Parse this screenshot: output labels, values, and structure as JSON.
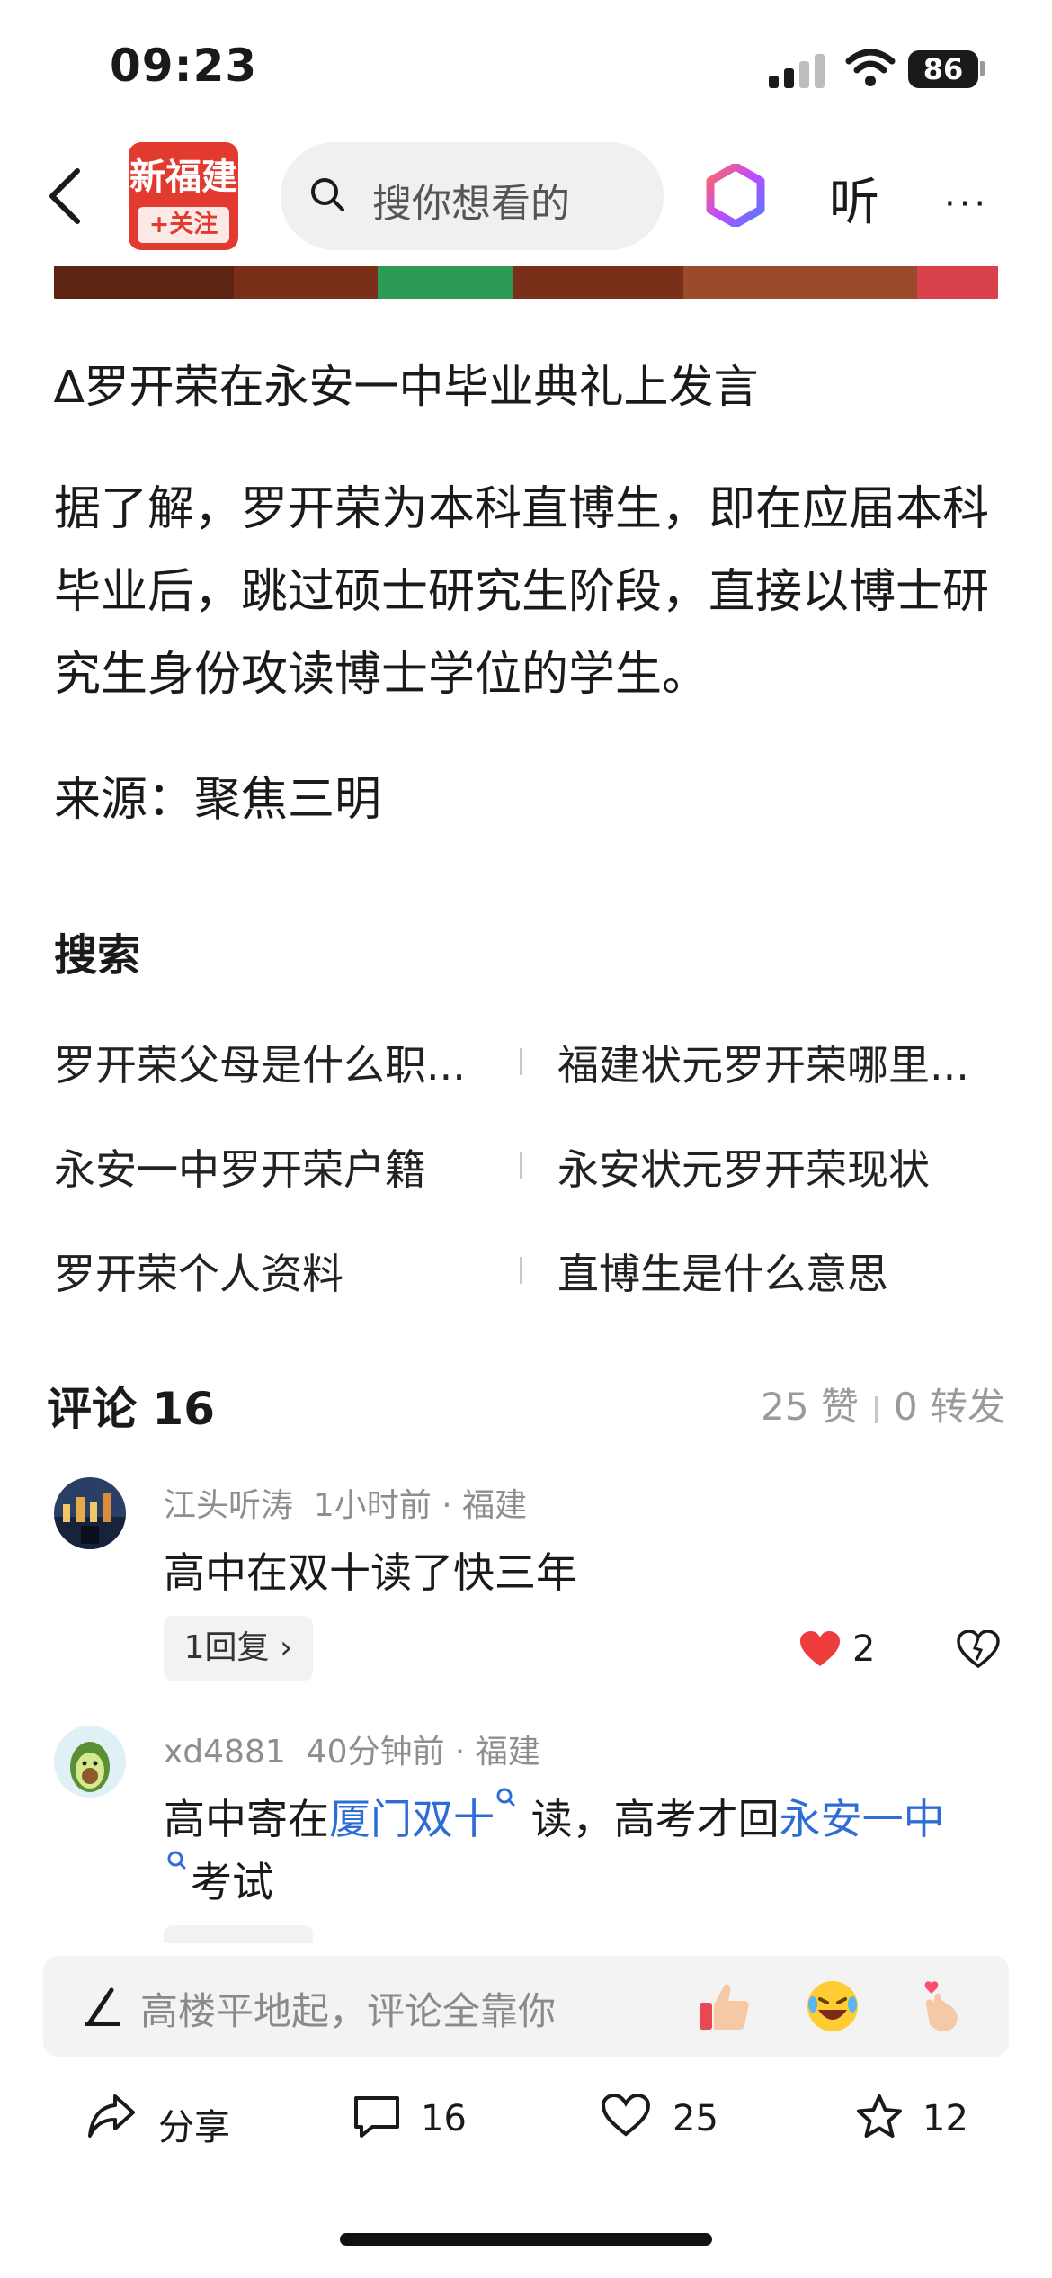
{
  "status": {
    "time": "09:23",
    "battery": "86"
  },
  "header": {
    "logo_top": "新福建",
    "follow_label": "+关注",
    "search_placeholder": "搜你想看的",
    "listen_label": "听",
    "more_label": "···"
  },
  "article": {
    "caption": "∆罗开荣在永安一中毕业典礼上发言",
    "paragraph": "据了解，罗开荣为本科直博生，即在应届本科毕业后，跳过硕士研究生阶段，直接以博士研究生身份攻读博士学位的学生。",
    "source": "来源：聚焦三明"
  },
  "search_section": {
    "title": "搜索",
    "suggestions": [
      "罗开荣父母是什么职...",
      "福建状元罗开荣哪里...",
      "永安一中罗开荣户籍",
      "永安状元罗开荣现状",
      "罗开荣个人资料",
      "直博生是什么意思"
    ]
  },
  "comments_header": {
    "title": "评论 16",
    "likes": "25 赞",
    "forwards": "0 转发"
  },
  "comments": [
    {
      "user": "江头听涛",
      "meta": "1小时前 · 福建",
      "text": "高中在双十读了快三年",
      "reply_label": "1回复",
      "like_count": "2"
    },
    {
      "user": "xd4881",
      "meta": "40分钟前 · 福建",
      "text_a": "高中寄在",
      "link1": "厦门双十",
      "text_b": " 读，高考才回",
      "link2": "永安一中",
      "text_c": "考试"
    }
  ],
  "input_bar": {
    "placeholder": "高楼平地起，评论全靠你"
  },
  "actions": {
    "share": "分享",
    "comments": "16",
    "likes": "25",
    "favorites": "12"
  },
  "colors": {
    "brand": "#e33a2f",
    "link": "#2f6dd6",
    "like": "#ee3b3b"
  }
}
